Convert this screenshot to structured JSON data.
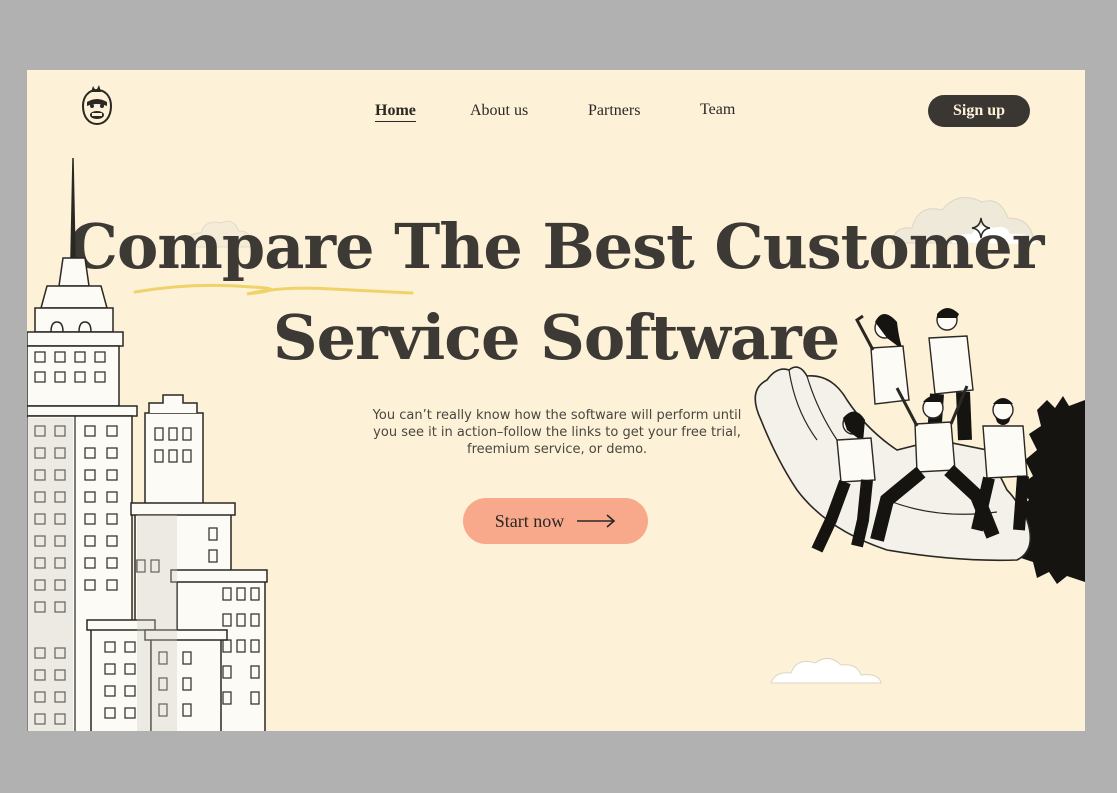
{
  "nav": {
    "items": [
      {
        "label": "Home",
        "active": true
      },
      {
        "label": "About us",
        "active": false
      },
      {
        "label": "Partners",
        "active": false
      },
      {
        "label": "Team",
        "active": false
      }
    ],
    "signup_label": "Sign up"
  },
  "hero": {
    "title_line1": "Compare The Best Customer",
    "title_line2": "Service Software",
    "subtitle": "You can’t really know how the software will perform until you see it in action–follow the links to get your free trial, freemium service, or demo.",
    "cta_label": "Start now",
    "cta_icon": "arrow-right-icon"
  },
  "icons": {
    "logo": "gorilla-logo-icon",
    "sparkle": "sparkle-icon"
  },
  "colors": {
    "background": "#fdf2d8",
    "frame": "#b1b1b1",
    "dark": "#3a3631",
    "accent_cta": "#f8a98b",
    "underline_scribble": "#f0d26a"
  }
}
